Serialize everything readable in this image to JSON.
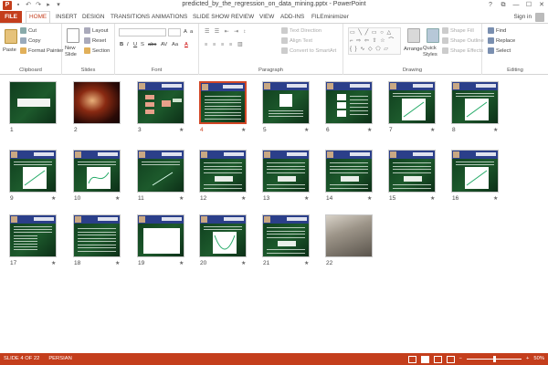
{
  "window": {
    "title": "predicted_by_the_regression_on_data_mining.pptx - PowerPoint",
    "app_icon": "P",
    "controls": [
      "?",
      "⧉",
      "—",
      "☐",
      "✕"
    ]
  },
  "qat": [
    "save-icon",
    "undo-icon",
    "redo-icon",
    "start-icon",
    "customize-icon"
  ],
  "ribbon_tabs": [
    "FILE",
    "HOME",
    "INSERT",
    "DESIGN",
    "TRANSITIONS",
    "ANIMATIONS",
    "SLIDE SHOW",
    "REVIEW",
    "VIEW",
    "ADD-INS",
    "FILEminimizer"
  ],
  "active_tab": "HOME",
  "signin": "Sign in",
  "groups": {
    "clipboard": {
      "label": "Clipboard",
      "paste": "Paste",
      "cut": "Cut",
      "copy": "Copy",
      "format_painter": "Format Painter"
    },
    "slides": {
      "label": "Slides",
      "new_slide": "New Slide",
      "layout": "Layout",
      "reset": "Reset",
      "section": "Section"
    },
    "font": {
      "label": "Font",
      "bold": "B",
      "italic": "I",
      "underline": "U",
      "shadow": "S",
      "strike": "abc",
      "spacing": "AV",
      "case": "Aa",
      "color": "A"
    },
    "paragraph": {
      "label": "Paragraph",
      "text_direction": "Text Direction",
      "align_text": "Align Text",
      "convert_smartart": "Convert to SmartArt"
    },
    "drawing": {
      "label": "Drawing",
      "arrange": "Arrange",
      "quick_styles": "Quick Styles",
      "shape_fill": "Shape Fill",
      "shape_outline": "Shape Outline",
      "shape_effects": "Shape Effects"
    },
    "editing": {
      "label": "Editing",
      "find": "Find",
      "replace": "Replace",
      "select": "Select"
    }
  },
  "slides": [
    {
      "num": "1",
      "style": "dark",
      "star": false
    },
    {
      "num": "2",
      "style": "red",
      "star": false
    },
    {
      "num": "3",
      "style": "diagram",
      "star": true
    },
    {
      "num": "4",
      "style": "text",
      "star": true
    },
    {
      "num": "5",
      "style": "question",
      "star": true
    },
    {
      "num": "6",
      "style": "boxes",
      "star": true
    },
    {
      "num": "7",
      "style": "chart",
      "star": true
    },
    {
      "num": "8",
      "style": "chart",
      "star": true
    },
    {
      "num": "9",
      "style": "chart",
      "star": true
    },
    {
      "num": "10",
      "style": "curve",
      "star": true
    },
    {
      "num": "11",
      "style": "scatter",
      "star": true
    },
    {
      "num": "12",
      "style": "formula",
      "star": true
    },
    {
      "num": "13",
      "style": "formula",
      "star": true
    },
    {
      "num": "14",
      "style": "formula",
      "star": true
    },
    {
      "num": "15",
      "style": "formula",
      "star": true
    },
    {
      "num": "16",
      "style": "chart",
      "star": true
    },
    {
      "num": "17",
      "style": "table",
      "star": true
    },
    {
      "num": "18",
      "style": "text",
      "star": true
    },
    {
      "num": "19",
      "style": "whitebox",
      "star": true
    },
    {
      "num": "20",
      "style": "parabola",
      "star": true
    },
    {
      "num": "21",
      "style": "formula",
      "star": true
    },
    {
      "num": "22",
      "style": "photo",
      "star": false
    }
  ],
  "selected_slide": "4",
  "status": {
    "slide_info": "SLIDE 4 OF 22",
    "language": "PERSIAN",
    "zoom": "50%",
    "zoom_fraction": 0.5
  },
  "colors": {
    "accent": "#c43e1c",
    "selection": "#d24726",
    "slide_header": "#2b3f8a",
    "slide_bg": "#1d5a2c"
  }
}
